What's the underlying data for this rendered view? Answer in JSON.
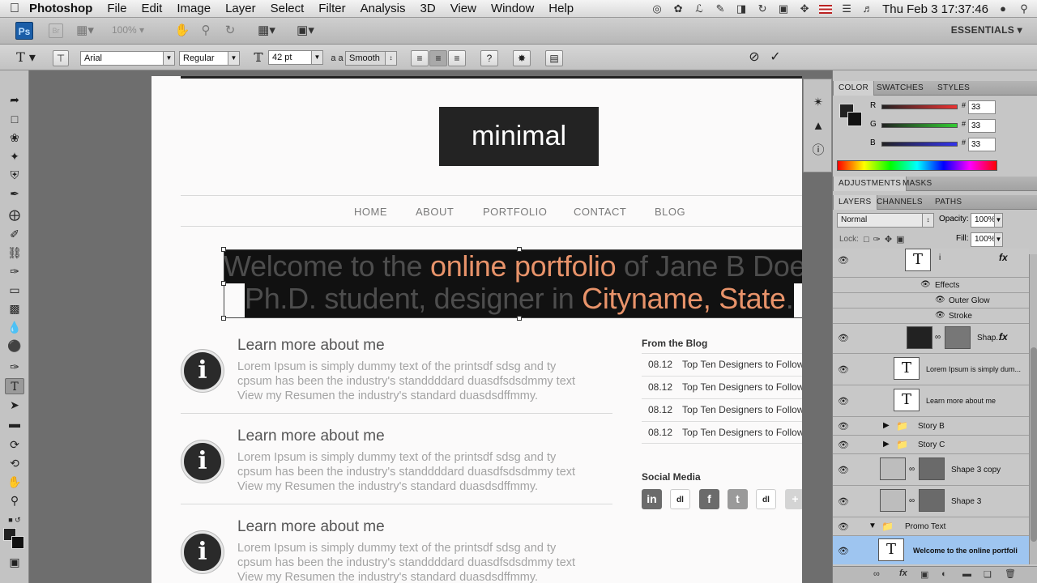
{
  "menubar": {
    "app_name": "Photoshop",
    "menus": [
      "File",
      "Edit",
      "Image",
      "Layer",
      "Select",
      "Filter",
      "Analysis",
      "3D",
      "View",
      "Window",
      "Help"
    ],
    "clock": "Thu Feb 3  17:37:46"
  },
  "appbar": {
    "logo": "Ps",
    "bridge": "Br",
    "zoom": "100%",
    "workspace": "ESSENTIALS ▾"
  },
  "options": {
    "font_family": "Arial",
    "font_style": "Regular",
    "font_size": "42 pt",
    "aa_label": "a a",
    "antialias": "Smooth"
  },
  "document": {
    "logo_text": "minimal",
    "nav": [
      "HOME",
      "ABOUT",
      "PORTFOLIO",
      "CONTACT",
      "BLOG"
    ],
    "banner_line1_pre": "Welcome to the ",
    "banner_line1_hl": "online portfolio",
    "banner_line1_post": " of Jane B Doe,",
    "banner_line2_pre": "Ph.D. student, designer in ",
    "banner_line2_hl": "Cityname, State",
    "banner_line2_post": ".",
    "sections": [
      {
        "title": "Learn more about me",
        "lines": [
          "Lorem Ipsum is simply dummy text of the printsdf sdsg and ty",
          "cpsum has been the industry's standdddard duasdfsdsdmmy text",
          "View my Resumen the industry's standard duasdsdffmmy."
        ]
      },
      {
        "title": "Learn more about me",
        "lines": [
          "Lorem Ipsum is simply dummy text of the printsdf sdsg and ty",
          "cpsum has been the industry's standdddard duasdfsdsdmmy text",
          "View my Resumen the industry's standard duasdsdffmmy."
        ]
      },
      {
        "title": "Learn more about me",
        "lines": [
          "Lorem Ipsum is simply dummy text of the printsdf sdsg and ty",
          "cpsum has been the industry's standdddard duasdfsdsdmmy text",
          "View my Resumen the industry's standard duasdsdffmmy."
        ]
      }
    ],
    "blog_title": "From the Blog",
    "blog_posts": [
      {
        "date": "08.12",
        "title": "Top Ten Designers to Follow on Twit"
      },
      {
        "date": "08.12",
        "title": "Top Ten Designers to Follow on Twit"
      },
      {
        "date": "08.12",
        "title": "Top Ten Designers to Follow on Twit"
      },
      {
        "date": "08.12",
        "title": "Top Ten Designers to Follow on Twit"
      }
    ],
    "social_title": "Social Media",
    "social_icons": [
      "in",
      "dl",
      "f",
      "t",
      "dl",
      "+"
    ]
  },
  "color_panel": {
    "tabs": [
      "COLOR",
      "SWATCHES",
      "STYLES"
    ],
    "r_label": "R",
    "g_label": "G",
    "b_label": "B",
    "r": "33",
    "g": "33",
    "b": "33"
  },
  "adjust_tabs": [
    "ADJUSTMENTS",
    "MASKS"
  ],
  "layers_panel": {
    "tabs": [
      "LAYERS",
      "CHANNELS",
      "PATHS"
    ],
    "blend_mode": "Normal",
    "opacity_label": "Opacity:",
    "opacity": "100%",
    "lock_label": "Lock:",
    "fill_label": "Fill:",
    "fill": "100%",
    "top_layer_name": "i",
    "effects_label": "Effects",
    "effect_1": "Outer Glow",
    "effect_2": "Stroke",
    "shape_layer": "Shap...",
    "text_layer_1": "Lorem Ipsum is simply dum...",
    "text_layer_2": "Learn more about me",
    "group_1": "Story B",
    "group_2": "Story C",
    "shape_copy": "Shape 3 copy",
    "shape_3": "Shape 3",
    "group_promo": "Promo Text",
    "selected_layer": "Welcome to the online portfoli"
  }
}
